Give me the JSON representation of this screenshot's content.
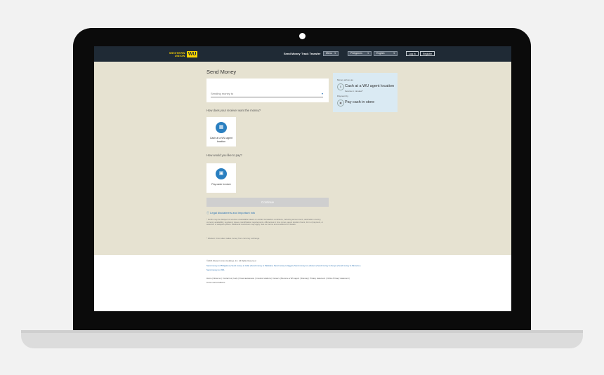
{
  "header": {
    "logo_line1": "WESTERN",
    "logo_line2": "UNION",
    "logo_mark": "WU",
    "nav_send_money": "Send Money",
    "nav_track_transfer": "Track Transfer",
    "menu_label": "Menu",
    "country_value": "Philippines",
    "language_value": "English",
    "login_label": "Log In",
    "register_label": "Register"
  },
  "form": {
    "title": "Send Money",
    "sending_placeholder": "Sending money to",
    "receive_question": "How does your receiver want the money?",
    "receive_option": "Cash at a WU agent location",
    "pay_question": "How would you like to pay?",
    "pay_option": "Pay cash in store",
    "continue_label": "Continue",
    "legal_link": "Legal disclaimers and important info",
    "disclaimer1": "* Funds may be delayed or services unavailable based on certain transaction conditions, including amount sent, destination country, currency availability, regulatory issues, identification requirements, differences in time zones, agent location hours, form of payment, or selection of delayed options. Additional restrictions may apply. See our terms and conditions for details.",
    "disclaimer2": "* Western Union also makes money from currency exchange."
  },
  "summary": {
    "money_arrives_label": "Money arrives as",
    "arrives_value": "Cash at a WU agent location",
    "service_note": "Service in minutes*",
    "payment_label": "Payment by",
    "payment_value": "Pay cash in store"
  },
  "footer": {
    "copyright": "©2016 Western Union Holdings, Inc. All Rights Reserved",
    "links_row1": "Send money to Philippines | Send money to India | Send money to Pakistan | Send money to Egypt | Send money to Lebanon | Send money to Kenya | Send money to Morocco |",
    "links_row2": "Send money to USA",
    "links_row3": "Home | About us | Contact us | Help | Fraud awareness | Investor relations | Careers | Become a WU agent | Sitemap | Privacy statement | Online Privacy statement |",
    "links_row4": "Terms and conditions"
  }
}
